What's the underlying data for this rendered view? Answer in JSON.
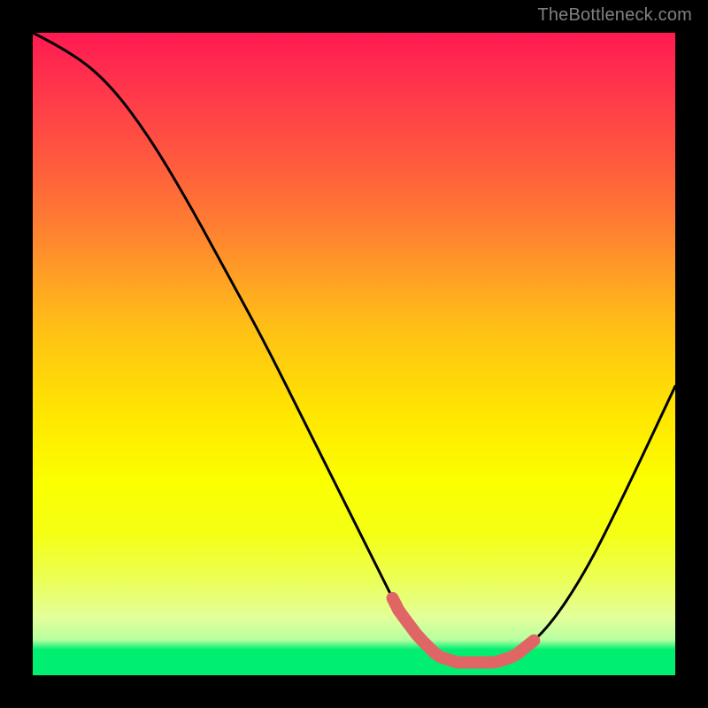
{
  "watermark": "TheBottleneck.com",
  "colors": {
    "background": "#000000",
    "curve_stroke": "#000000",
    "highlight_stroke": "#e06666",
    "highlight_dot": "#e06666"
  },
  "chart_data": {
    "type": "line",
    "title": "",
    "xlabel": "",
    "ylabel": "",
    "xlim": [
      0,
      100
    ],
    "ylim": [
      0,
      100
    ],
    "series": [
      {
        "name": "bottleneck-curve",
        "x": [
          0,
          6,
          12,
          18,
          24,
          30,
          36,
          42,
          48,
          54,
          57,
          60,
          63,
          66,
          69,
          72,
          75,
          80,
          86,
          92,
          100
        ],
        "values": [
          100,
          97,
          92,
          84,
          74,
          63,
          52,
          40,
          28,
          16,
          10,
          6,
          3,
          2,
          2,
          2,
          3,
          7,
          16,
          28,
          45
        ]
      }
    ],
    "annotations": {
      "highlight_range_x": [
        56,
        78
      ],
      "highlight_dots_x": [
        56.5,
        58.5
      ]
    }
  }
}
